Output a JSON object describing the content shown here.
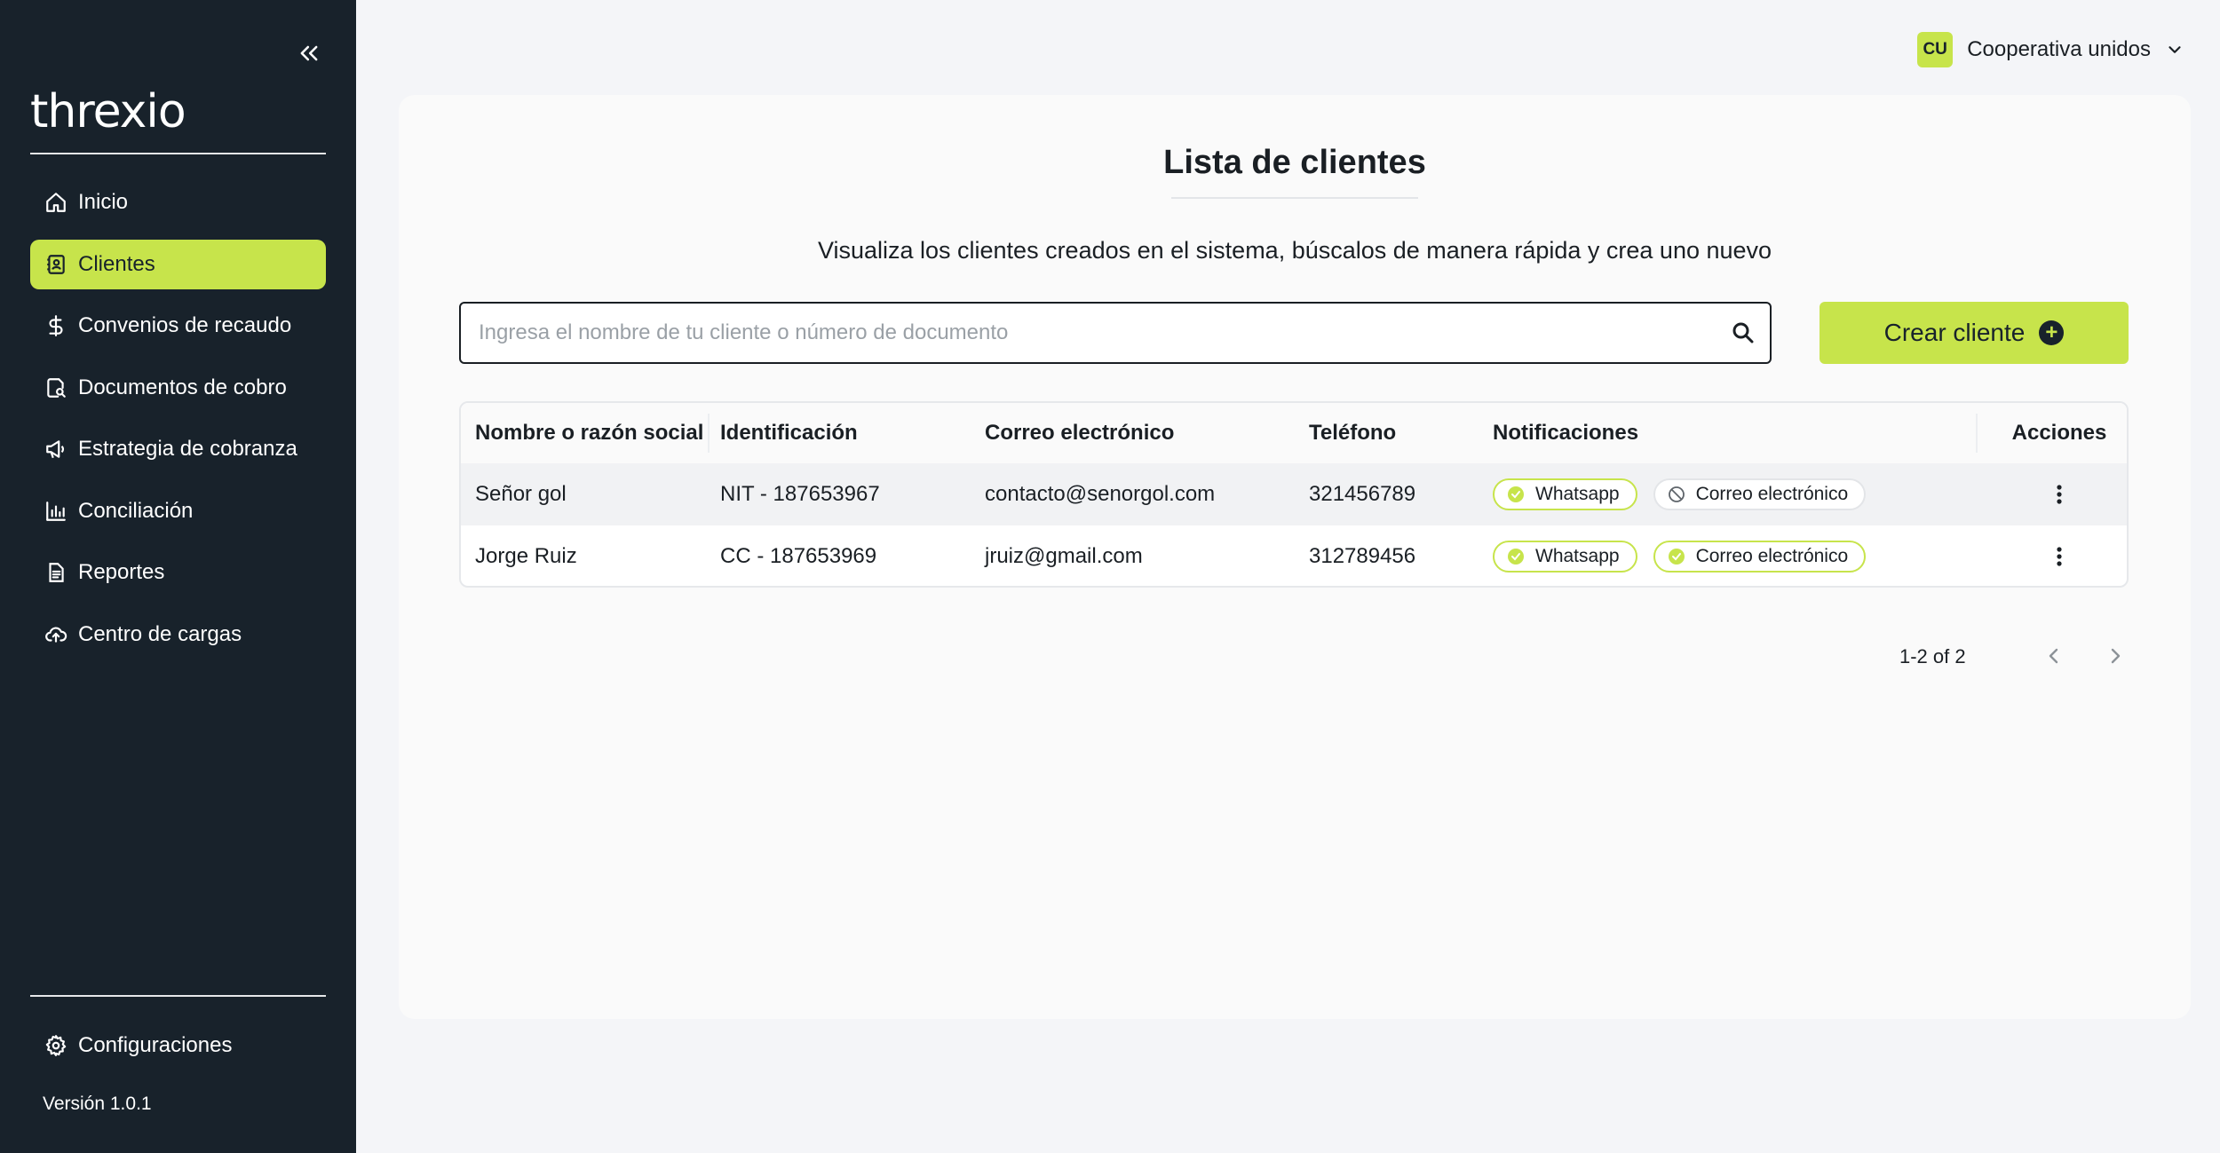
{
  "sidebar": {
    "logo": "threxio",
    "items": [
      {
        "label": "Inicio",
        "icon": "home-icon",
        "active": false
      },
      {
        "label": "Clientes",
        "icon": "contacts-icon",
        "active": true
      },
      {
        "label": "Convenios de recaudo",
        "icon": "dollar-icon",
        "active": false
      },
      {
        "label": "Documentos de cobro",
        "icon": "document-search-icon",
        "active": false
      },
      {
        "label": "Estrategia de cobranza",
        "icon": "megaphone-icon",
        "active": false
      },
      {
        "label": "Conciliación",
        "icon": "bar-chart-icon",
        "active": false
      },
      {
        "label": "Reportes",
        "icon": "report-icon",
        "active": false
      },
      {
        "label": "Centro de cargas",
        "icon": "cloud-upload-icon",
        "active": false
      }
    ],
    "config_label": "Configuraciones",
    "version": "Versión 1.0.1"
  },
  "org": {
    "initials": "CU",
    "name": "Cooperativa unidos"
  },
  "main": {
    "title": "Lista de clientes",
    "subtitle": "Visualiza los clientes creados en el sistema, búscalos de manera rápida y crea uno nuevo",
    "search_placeholder": "Ingresa el nombre de tu cliente o número de documento",
    "search_value": "",
    "create_label": "Crear cliente"
  },
  "table": {
    "columns": [
      "Nombre o razón social",
      "Identificación",
      "Correo electrónico",
      "Teléfono",
      "Notificaciones",
      "Acciones"
    ],
    "rows": [
      {
        "name": "Señor gol",
        "id": "NIT - 187653967",
        "email": "contacto@senorgol.com",
        "phone": "321456789",
        "notifications": [
          {
            "label": "Whatsapp",
            "enabled": true
          },
          {
            "label": "Correo electrónico",
            "enabled": false
          }
        ]
      },
      {
        "name": "Jorge Ruiz",
        "id": "CC - 187653969",
        "email": "jruiz@gmail.com",
        "phone": "312789456",
        "notifications": [
          {
            "label": "Whatsapp",
            "enabled": true
          },
          {
            "label": "Correo electrónico",
            "enabled": true
          }
        ]
      }
    ]
  },
  "pagination": {
    "info": "1-2 of 2"
  },
  "colors": {
    "accent": "#c7e44b",
    "sidebar_bg": "#18222b",
    "page_bg": "#f4f5f8"
  }
}
